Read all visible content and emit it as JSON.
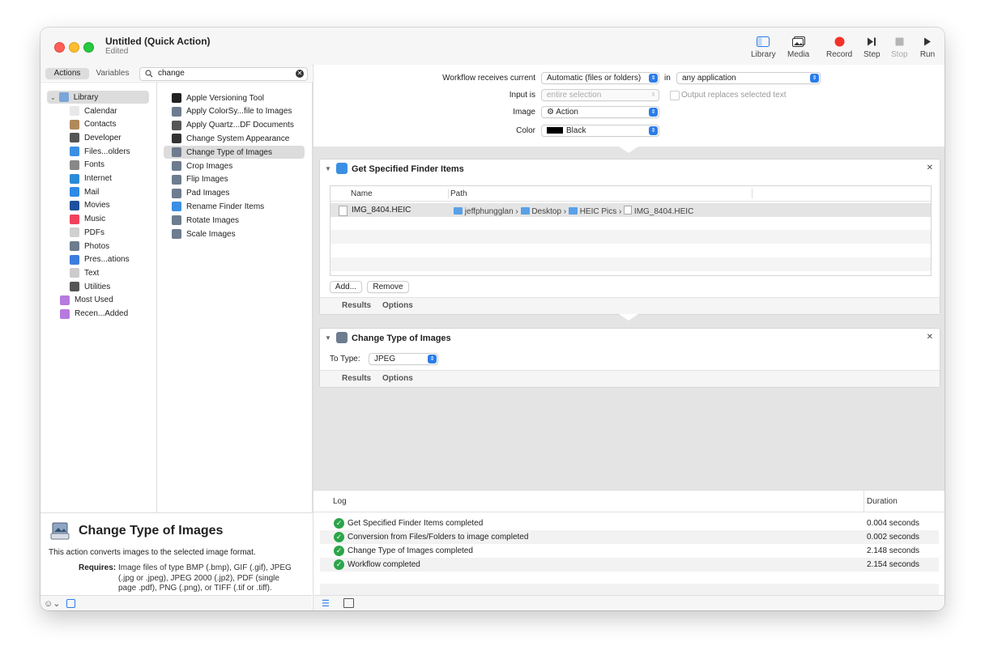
{
  "window": {
    "title": "Untitled (Quick Action)",
    "subtitle": "Edited"
  },
  "toolbar": {
    "library": "Library",
    "media": "Media",
    "record": "Record",
    "step": "Step",
    "stop": "Stop",
    "run": "Run"
  },
  "left": {
    "tab_actions": "Actions",
    "tab_variables": "Variables",
    "search_value": "change",
    "library_items": [
      {
        "label": "Library",
        "icon": "library-folder-icon",
        "color": "#7aa6d8"
      },
      {
        "label": "Calendar",
        "icon": "calendar-icon",
        "color": "#e8e8e8"
      },
      {
        "label": "Contacts",
        "icon": "contacts-icon",
        "color": "#b08a5a"
      },
      {
        "label": "Developer",
        "icon": "developer-tools-icon",
        "color": "#555555"
      },
      {
        "label": "Files...olders",
        "icon": "finder-icon",
        "color": "#3b8fe3"
      },
      {
        "label": "Fonts",
        "icon": "fonts-icon",
        "color": "#888888"
      },
      {
        "label": "Internet",
        "icon": "globe-icon",
        "color": "#2a8ad8"
      },
      {
        "label": "Mail",
        "icon": "mail-icon",
        "color": "#2e8ae6"
      },
      {
        "label": "Movies",
        "icon": "movies-icon",
        "color": "#1d4f9c"
      },
      {
        "label": "Music",
        "icon": "music-icon",
        "color": "#f0425c"
      },
      {
        "label": "PDFs",
        "icon": "pdf-icon",
        "color": "#d0d0d0"
      },
      {
        "label": "Photos",
        "icon": "photos-icon",
        "color": "#6d7c8f"
      },
      {
        "label": "Pres...ations",
        "icon": "presentations-icon",
        "color": "#3b7ddd"
      },
      {
        "label": "Text",
        "icon": "text-icon",
        "color": "#cccccc"
      },
      {
        "label": "Utilities",
        "icon": "utilities-icon",
        "color": "#555555"
      },
      {
        "label": "Most Used",
        "icon": "smart-folder-icon",
        "color": "#b77adf"
      },
      {
        "label": "Recen...Added",
        "icon": "smart-folder-icon",
        "color": "#b77adf"
      }
    ],
    "actions": [
      {
        "label": "Apple Versioning Tool",
        "icon": "terminal-icon",
        "color": "#222222"
      },
      {
        "label": "Apply ColorSy...file to Images",
        "icon": "preview-icon",
        "color": "#6d7c8f"
      },
      {
        "label": "Apply Quartz...DF Documents",
        "icon": "utilities-icon",
        "color": "#555555"
      },
      {
        "label": "Change System Appearance",
        "icon": "system-appearance-icon",
        "color": "#333333"
      },
      {
        "label": "Change Type of Images",
        "icon": "preview-icon",
        "color": "#6d7c8f"
      },
      {
        "label": "Crop Images",
        "icon": "preview-icon",
        "color": "#6d7c8f"
      },
      {
        "label": "Flip Images",
        "icon": "preview-icon",
        "color": "#6d7c8f"
      },
      {
        "label": "Pad Images",
        "icon": "preview-icon",
        "color": "#6d7c8f"
      },
      {
        "label": "Rename Finder Items",
        "icon": "finder-icon",
        "color": "#3b8fe3"
      },
      {
        "label": "Rotate Images",
        "icon": "preview-icon",
        "color": "#6d7c8f"
      },
      {
        "label": "Scale Images",
        "icon": "preview-icon",
        "color": "#6d7c8f"
      }
    ],
    "description": {
      "title": "Change Type of Images",
      "text": "This action converts images to the selected image format.",
      "requires_label": "Requires:",
      "requires_text": "Image files of type BMP (.bmp), GIF (.gif), JPEG (.jpg or .jpeg), JPEG 2000 (.jp2), PDF (single page .pdf), PNG (.png), or TIFF (.tif or .tiff)."
    }
  },
  "workflow_settings": {
    "receives_label": "Workflow receives current",
    "receives_value": "Automatic (files or folders)",
    "in_label": "in",
    "app_value": "any application",
    "input_is_label": "Input is",
    "input_is_value": "entire selection",
    "output_replaces_label": "Output replaces selected text",
    "image_label": "Image",
    "image_value": "⚙ Action",
    "color_label": "Color",
    "color_value": "Black"
  },
  "action1": {
    "title": "Get Specified Finder Items",
    "col_name": "Name",
    "col_path": "Path",
    "row_name": "IMG_8404.HEIC",
    "path": [
      "jeffphungglan",
      "Desktop",
      "HEIC Pics",
      "IMG_8404.HEIC"
    ],
    "add_button": "Add...",
    "remove_button": "Remove",
    "results_tab": "Results",
    "options_tab": "Options"
  },
  "action2": {
    "title": "Change Type of Images",
    "to_type_label": "To Type:",
    "to_type_value": "JPEG",
    "results_tab": "Results",
    "options_tab": "Options"
  },
  "log": {
    "col_log": "Log",
    "col_duration": "Duration",
    "rows": [
      {
        "text": "Get Specified Finder Items completed",
        "duration": "0.004 seconds"
      },
      {
        "text": "Conversion from Files/Folders to image completed",
        "duration": "0.002 seconds"
      },
      {
        "text": "Change Type of Images completed",
        "duration": "2.148 seconds"
      },
      {
        "text": "Workflow completed",
        "duration": "2.154 seconds"
      }
    ]
  }
}
